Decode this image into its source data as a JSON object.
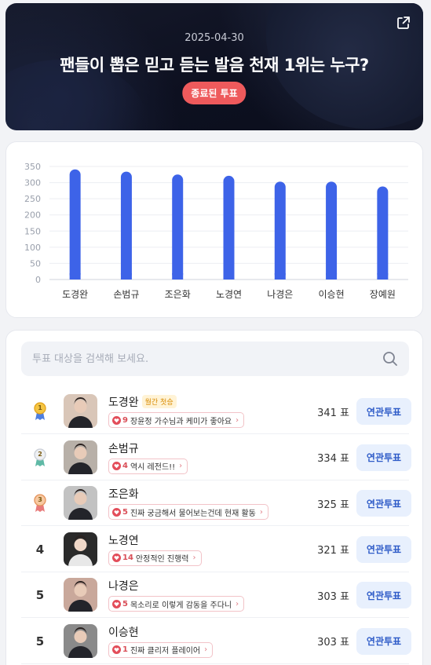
{
  "banner": {
    "date": "2025-04-30",
    "title": "팬들이 뽑은 믿고 듣는 발음 천재 1위는 누구?",
    "badge": "종료된 투표",
    "share_icon": "external-link-icon"
  },
  "chart_data": {
    "type": "bar",
    "categories": [
      "도경완",
      "손범규",
      "조은화",
      "노경연",
      "나경은",
      "이승현",
      "장예원"
    ],
    "values": [
      341,
      334,
      325,
      321,
      303,
      303,
      288
    ],
    "ylim": [
      0,
      350
    ],
    "yticks": [
      0,
      50,
      100,
      150,
      200,
      250,
      300,
      350
    ],
    "grid": true,
    "bar_color": "#3d63e8"
  },
  "search": {
    "placeholder": "투표 대상을 검색해 보세요."
  },
  "list": {
    "vote_suffix": "표",
    "related_label": "연관투표",
    "items": [
      {
        "rank": "1",
        "medal": "gold",
        "name": "도경완",
        "tag": "월간 첫승",
        "comment_count": "9",
        "comment": "장윤정 가수님과 케미가 좋아요",
        "votes": "341 표"
      },
      {
        "rank": "2",
        "medal": "silver",
        "name": "손범규",
        "tag": "",
        "comment_count": "4",
        "comment": "역시 레전드!!",
        "votes": "334 표"
      },
      {
        "rank": "3",
        "medal": "bronze",
        "name": "조은화",
        "tag": "",
        "comment_count": "5",
        "comment": "진짜 궁금해서 물어보는건데 현재 활동",
        "votes": "325 표"
      },
      {
        "rank": "4",
        "medal": "",
        "name": "노경연",
        "tag": "",
        "comment_count": "14",
        "comment": "안정적인 진행력",
        "votes": "321 표"
      },
      {
        "rank": "5",
        "medal": "",
        "name": "나경은",
        "tag": "",
        "comment_count": "5",
        "comment": "목소리로 이렇게 감동을 주다니",
        "votes": "303 표"
      },
      {
        "rank": "5",
        "medal": "",
        "name": "이승현",
        "tag": "",
        "comment_count": "1",
        "comment": "진짜 클리저 플레이어",
        "votes": "303 표"
      }
    ]
  }
}
